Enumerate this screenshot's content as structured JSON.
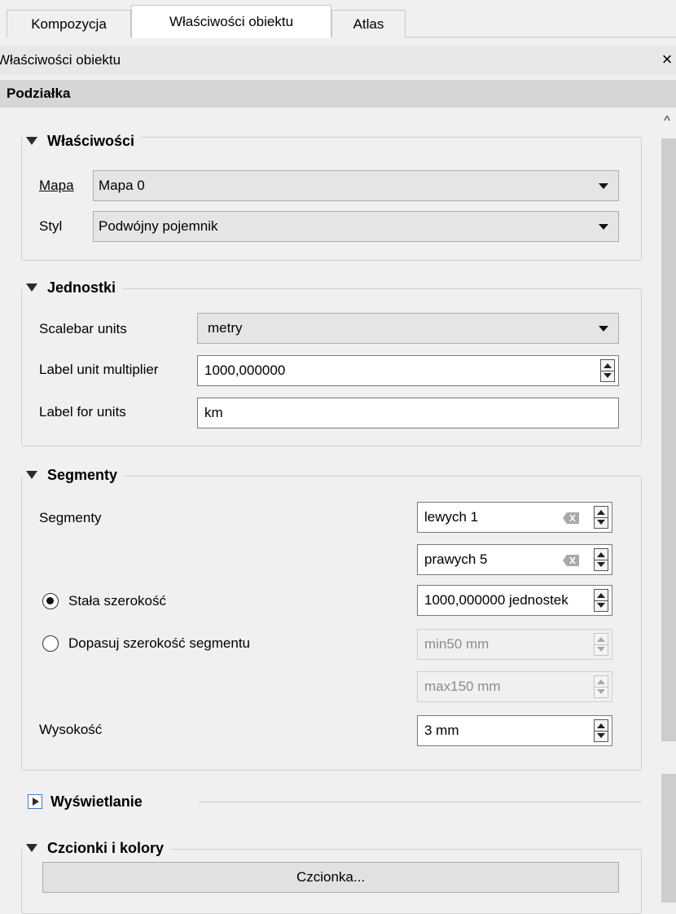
{
  "tabs": [
    {
      "label": "Kompozycja"
    },
    {
      "label": "Właściwości obiektu"
    },
    {
      "label": "Atlas"
    }
  ],
  "dock": {
    "title": "Właściwości obiektu",
    "close_label": "×"
  },
  "panel": {
    "title": "Podziałka"
  },
  "groups": {
    "properties": {
      "title": "Właściwości",
      "map_label": "Mapa",
      "map_value": "Mapa 0",
      "style_label": "Styl",
      "style_value": "Podwójny pojemnik"
    },
    "units": {
      "title": "Jednostki",
      "scalebar_units_label": "Scalebar units",
      "scalebar_units_value": "metry",
      "label_multiplier_label": "Label unit multiplier",
      "label_multiplier_value": "1000,000000",
      "label_units_label": "Label for units",
      "label_units_value": "km"
    },
    "segments": {
      "title": "Segmenty",
      "segments_label": "Segmenty",
      "left_value": "lewych 1",
      "right_value": "prawych 5",
      "fixed_width_label": "Stała szerokość",
      "fixed_width_value": "1000,000000 jednostek",
      "fit_width_label": "Dopasuj szerokość segmentu",
      "min_value": "min50 mm",
      "max_value": "max150 mm",
      "height_label": "Wysokość",
      "height_value": "3 mm"
    },
    "display": {
      "title": "Wyświetlanie"
    },
    "fonts": {
      "title": "Czcionki i kolory",
      "font_button": "Czcionka..."
    }
  },
  "icons": {
    "collapse": "triangle-down-icon",
    "expand": "triangle-right-icon",
    "clear": "clear-text-icon",
    "scroll_up": "chevron-up-icon"
  }
}
